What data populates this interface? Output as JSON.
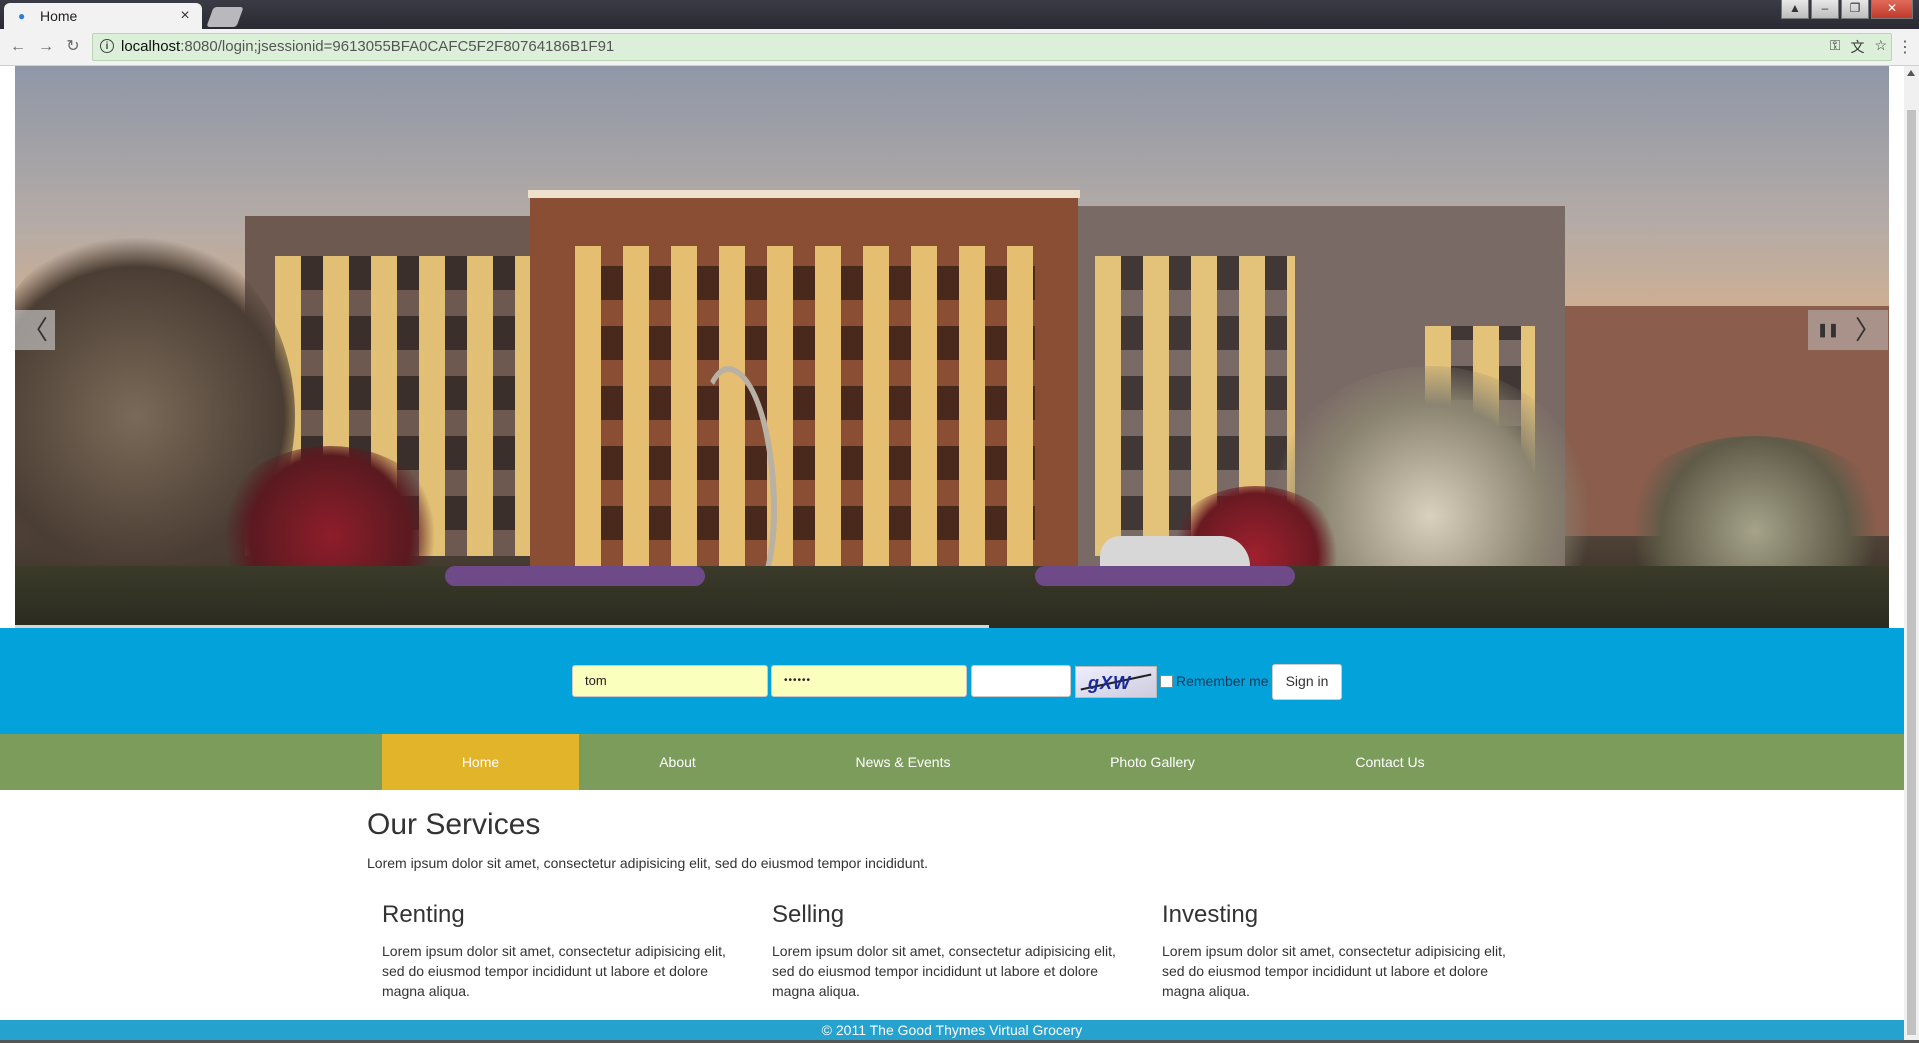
{
  "browser": {
    "tab_title": "Home",
    "tab_close": "×",
    "url_host": "localhost",
    "url_path": ":8080/login;jsessionid=9613055BFA0CAFC5F2F80764186B1F91",
    "info_icon": "i",
    "back_icon": "←",
    "forward_icon": "→",
    "reload_icon": "↻",
    "menu_icon": "⋮",
    "window_controls": [
      "▲",
      "–",
      "❐",
      "✕"
    ]
  },
  "hero": {
    "prev_arrow": "〈",
    "next_arrow": "〉",
    "pause_icon": "❚❚"
  },
  "slider_progress": 0.52,
  "login": {
    "username_value": "tom",
    "password_value": "••••••",
    "captcha_value": "",
    "captcha_text": "gXW",
    "remember_label": "Remember me",
    "signin_label": "Sign in"
  },
  "nav": {
    "items": [
      {
        "label": "Home",
        "active": true
      },
      {
        "label": "About",
        "active": false
      },
      {
        "label": "News & Events",
        "active": false
      },
      {
        "label": "Photo Gallery",
        "active": false
      },
      {
        "label": "Contact Us",
        "active": false
      }
    ]
  },
  "services": {
    "title": "Our Services",
    "intro": "Lorem ipsum dolor sit amet, consectetur adipisicing elit, sed do eiusmod tempor incididunt.",
    "columns": [
      {
        "title": "Renting",
        "text": "Lorem ipsum dolor sit amet, consectetur adipisicing elit, sed do eiusmod tempor incididunt ut labore et dolore magna aliqua."
      },
      {
        "title": "Selling",
        "text": "Lorem ipsum dolor sit amet, consectetur adipisicing elit, sed do eiusmod tempor incididunt ut labore et dolore magna aliqua."
      },
      {
        "title": "Investing",
        "text": "Lorem ipsum dolor sit amet, consectetur adipisicing elit, sed do eiusmod tempor incididunt ut labore et dolore magna aliqua."
      }
    ]
  },
  "footer": {
    "text": "© 2011 The Good Thymes Virtual Grocery"
  },
  "colors": {
    "login_band": "#03a2da",
    "nav_bar": "#7b9c5b",
    "nav_active": "#e2b42a",
    "footer": "#25a2cd"
  }
}
